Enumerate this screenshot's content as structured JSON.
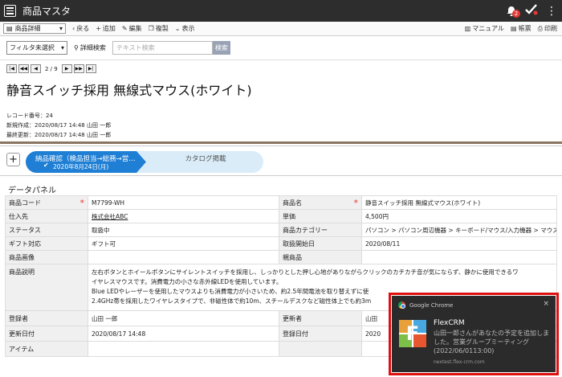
{
  "app": {
    "title": "商品マスタ",
    "notification_count": "2"
  },
  "toolbar": {
    "view_select": "商品詳細",
    "back": "戻る",
    "add": "追加",
    "edit": "編集",
    "copy": "複製",
    "display": "表示",
    "manual": "マニュアル",
    "form": "帳票",
    "print": "印刷"
  },
  "filter": {
    "select": "フィルタ未選択",
    "detail_search": "詳細検索",
    "search_placeholder": "テキスト検索",
    "search_button": "検索"
  },
  "record": {
    "pager": "2 / 9",
    "title": "静音スイッチ採用 無線式マウス(ホワイト)",
    "number": "レコード番号：24",
    "created": "新規作成：2020/08/17 14:48 山田 一郎",
    "updated": "最終更新：2020/08/17 14:48 山田 一郎"
  },
  "workflow": {
    "plus": "+",
    "step1_label": "納品確認（検品担当→総務→営…",
    "step1_date": "2020年8月24日(月)",
    "step2_label": "カタログ掲載"
  },
  "panel": {
    "title": "データパネル",
    "rows": [
      {
        "l1": "商品コード",
        "v1": "M7799-WH",
        "l2": "商品名",
        "v2": "静音スイッチ採用 無線式マウス(ホワイト)"
      },
      {
        "l1": "仕入先",
        "v1": "株式会社ABC",
        "l2": "単価",
        "v2": "4,500円"
      },
      {
        "l1": "ステータス",
        "v1": "取扱中",
        "l2": "商品カテゴリー",
        "v2": "パソコン > パソコン周辺機器 > キーボード/マウス/入力機器 > マウス"
      },
      {
        "l1": "ギフト対応",
        "v1": "ギフト可",
        "l2": "取扱開始日",
        "v2": "2020/08/11"
      },
      {
        "l1": "商品画像",
        "v1": "",
        "l2": "親商品",
        "v2": ""
      }
    ],
    "desc_label": "商品説明",
    "desc_lines": [
      "左右ボタンとホイールボタンにサイレントスイッチを採用し、しっかりとした押し心地がありながらクリックのカチカチ音が気にならず、静かに使用できるワ",
      "イヤレスマウスです。消費電力の小さな赤外線LEDを使用しています。",
      "Blue LEDやレーザーを使用したマウスよりも消費電力が小さいため、約2.5年間電池を取り替えずに使",
      "2.4GHz帯を採用したワイヤレスタイプで、非磁性体で約10m、スチールデスクなど磁性体上でも約3m"
    ],
    "bottom_rows": [
      {
        "l1": "登録者",
        "v1": "山田 一郎",
        "l2": "更新者",
        "v2": "山田"
      },
      {
        "l1": "更新日付",
        "v1": "2020/08/17 14:48",
        "l2": "登録日付",
        "v2": "2020"
      },
      {
        "l1": "アイテム",
        "v1": "",
        "l2": "",
        "v2": ""
      }
    ]
  },
  "toast": {
    "source": "Google Chrome",
    "close": "×",
    "app": "FlexCRM",
    "logo_letter": "F",
    "message": "山田一郎さんがあなたの予定を追加しました。営業グループミーティング (2022/06/0113:00)",
    "domain": "nextest.flex-crm.com"
  }
}
